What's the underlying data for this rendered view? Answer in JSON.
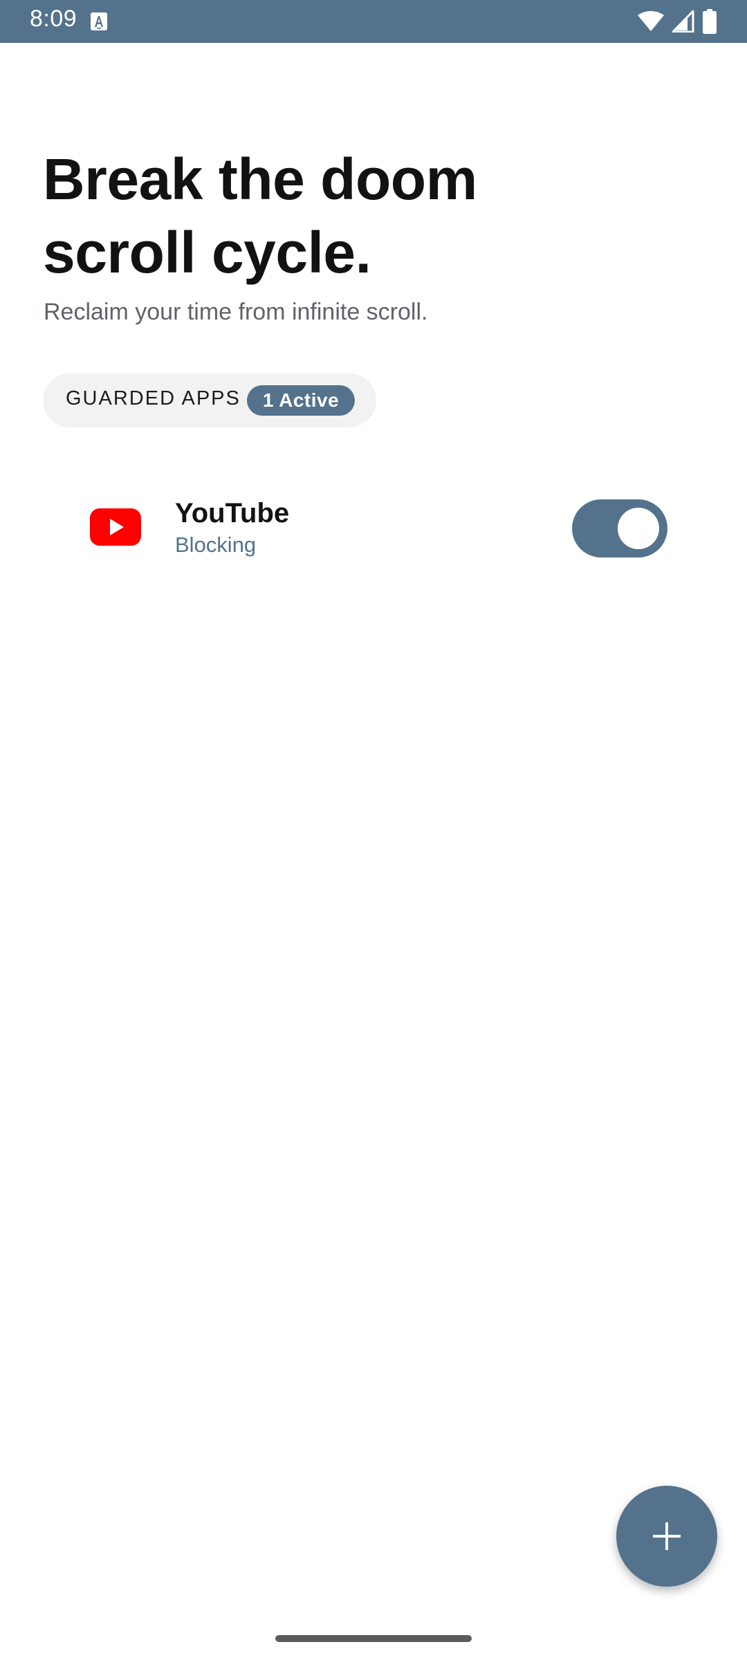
{
  "status_bar": {
    "time": "8:09",
    "background_color": "#54728c",
    "icons": [
      "text-a-icon",
      "wifi-icon",
      "signal-icon",
      "battery-icon"
    ]
  },
  "header": {
    "title_line_1": "Break the doom",
    "title_line_2": "scroll cycle.",
    "subtitle": "Reclaim your time from infinite scroll."
  },
  "guarded_section": {
    "label": "GUARDED APPS",
    "badge": "1 Active"
  },
  "apps": [
    {
      "name": "YouTube",
      "status": "Blocking",
      "icon": "youtube-icon",
      "enabled": true
    }
  ],
  "fab": {
    "icon": "plus-icon"
  },
  "colors": {
    "accent": "#54728c",
    "youtube_red": "#ff0000",
    "chip_background": "#f2f2f2",
    "text_primary": "#121212",
    "text_secondary": "#5f6368"
  }
}
